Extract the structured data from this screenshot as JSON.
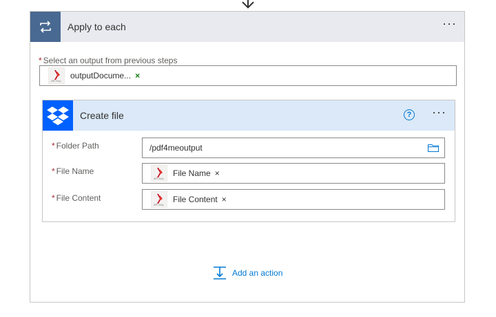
{
  "apply_to_each": {
    "title": "Apply to each",
    "more_label": "···",
    "select_label": "Select an output from previous steps",
    "required_mark": "*",
    "output_token": {
      "label": "outputDocume...",
      "remove": "×",
      "icon_caption": "API Key"
    }
  },
  "create_file": {
    "title": "Create file",
    "help_label": "?",
    "more_label": "···",
    "fields": [
      {
        "label": "Folder Path",
        "value": "/pdf4meoutput"
      },
      {
        "label": "File Name",
        "token": "File Name",
        "remove": "×",
        "icon_caption": "API Key"
      },
      {
        "label": "File Content",
        "token": "File Content",
        "remove": "×",
        "icon_caption": "API Key"
      }
    ]
  },
  "add_action": {
    "label": "Add an action"
  },
  "colors": {
    "apply_accent": "#486991",
    "dropbox_blue": "#0061fe",
    "link_blue": "#0078d4",
    "required_red": "#a4262c",
    "token_x_green": "#107c10"
  }
}
